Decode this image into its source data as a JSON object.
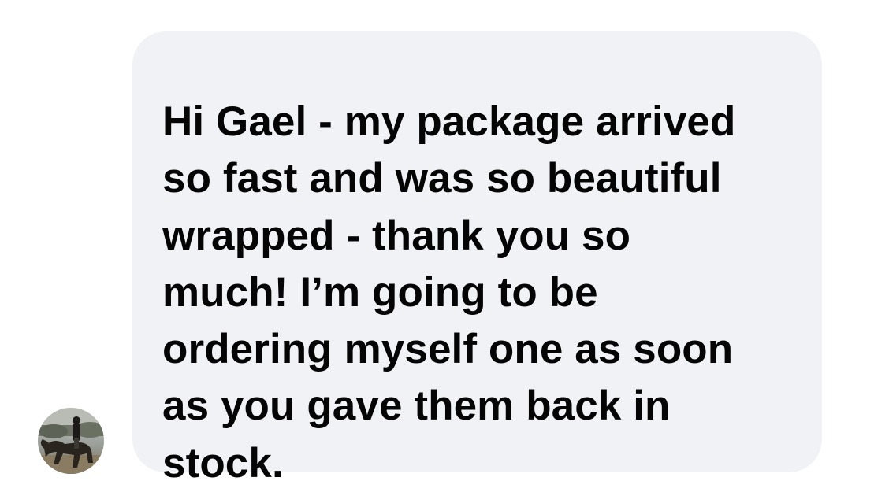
{
  "conversation": {
    "incoming_message": {
      "lines": [
        "Hi Gael - my package arrived",
        "so fast and was so beautiful",
        "wrapped - thank you so",
        "much! I’m going to be",
        "ordering myself one as soon",
        "as you gave them back in",
        "stock."
      ],
      "bubble_color": "#f0f2f5",
      "text_color": "#050505"
    },
    "sender": {
      "avatar_icon": "profile-photo-horse-rider-icon"
    }
  }
}
